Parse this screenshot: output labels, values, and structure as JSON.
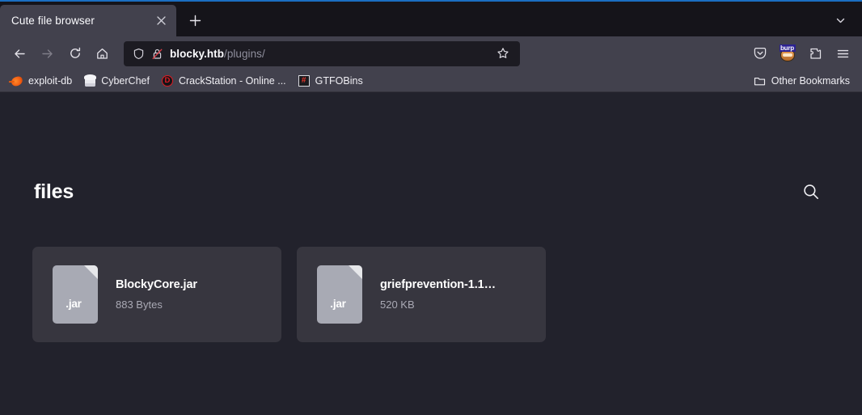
{
  "browser": {
    "tab": {
      "title": "Cute file browser",
      "close_icon": "close-icon"
    },
    "new_tab_label": "+",
    "nav": {
      "back": "back-icon",
      "forward": "forward-icon",
      "reload": "reload-icon",
      "home": "home-icon"
    },
    "url": {
      "host": "blocky.htb",
      "path": "/plugins/",
      "full": "blocky.htb/plugins/",
      "shield_icon": "shield-icon",
      "lock_icon": "lock-crossed-icon",
      "star_icon": "star-icon"
    },
    "toolbar": {
      "pocket": "pocket-icon",
      "burp_label": "burp",
      "burp": "burp-suite-icon",
      "extensions": "extensions-icon",
      "menu": "hamburger-menu-icon"
    },
    "bookmarks": [
      {
        "label": "exploit-db",
        "icon": "exploit-db-icon"
      },
      {
        "label": "CyberChef",
        "icon": "cyberchef-icon"
      },
      {
        "label": "CrackStation - Online ...",
        "icon": "crackstation-icon",
        "glyph": "D"
      },
      {
        "label": "GTFOBins",
        "icon": "gtfobins-icon",
        "glyph": "#"
      }
    ],
    "other_bookmarks": {
      "label": "Other Bookmarks",
      "icon": "folder-icon"
    }
  },
  "page": {
    "title": "files",
    "search_icon": "search-icon",
    "files": [
      {
        "name": "BlockyCore.jar",
        "size": "883 Bytes",
        "ext": ".jar"
      },
      {
        "name": "griefprevention-1.1…",
        "size": "520 KB",
        "ext": ".jar"
      }
    ]
  },
  "colors": {
    "page_bg": "#22222c",
    "card_bg": "#37363f",
    "chrome_bg": "#42414d",
    "tabstrip_bg": "#15141a",
    "urlbar_bg": "#1c1b22",
    "accent": "#1b6ec2",
    "file_icon": "#a8aab4",
    "muted_text": "#a9a9b4"
  }
}
